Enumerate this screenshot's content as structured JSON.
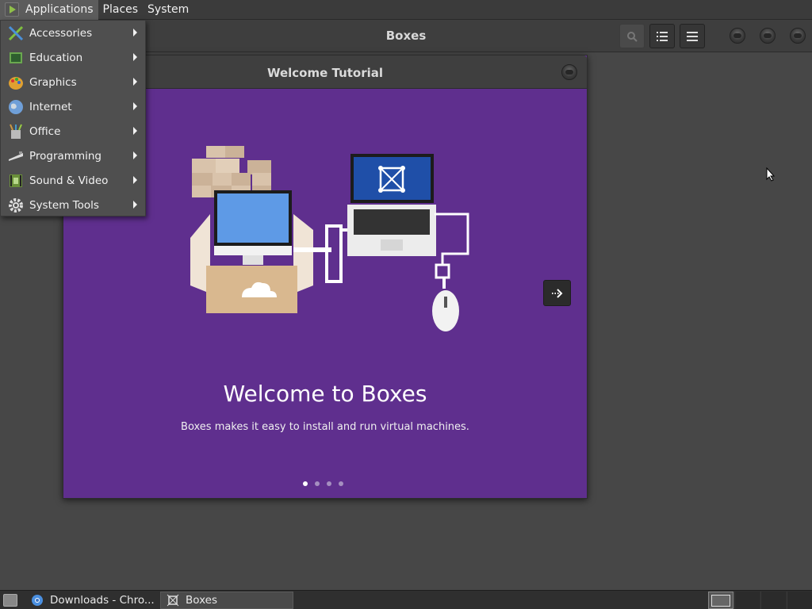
{
  "top_panel": {
    "menus": [
      {
        "label": "Applications",
        "active": true
      },
      {
        "label": "Places"
      },
      {
        "label": "System"
      }
    ]
  },
  "boxes_window": {
    "title": "Boxes"
  },
  "tutorial": {
    "title": "Welcome Tutorial",
    "heading": "Welcome to Boxes",
    "description": "Boxes makes it easy to install and run virtual machines.",
    "current_page": 1,
    "total_pages": 4
  },
  "applications_menu": {
    "items": [
      {
        "label": "Accessories",
        "icon": "accessories-icon"
      },
      {
        "label": "Education",
        "icon": "education-icon"
      },
      {
        "label": "Graphics",
        "icon": "graphics-icon"
      },
      {
        "label": "Internet",
        "icon": "internet-icon"
      },
      {
        "label": "Office",
        "icon": "office-icon"
      },
      {
        "label": "Programming",
        "icon": "programming-icon"
      },
      {
        "label": "Sound & Video",
        "icon": "sound-video-icon"
      },
      {
        "label": "System Tools",
        "icon": "system-tools-icon"
      }
    ]
  },
  "taskbar": {
    "tasks": [
      {
        "label": "Downloads - Chro...",
        "icon": "chrome-icon",
        "active": false
      },
      {
        "label": "Boxes",
        "icon": "boxes-icon",
        "active": true
      }
    ],
    "workspaces": 4
  },
  "colors": {
    "accent_purple": "#5f2f8e",
    "panel_bg": "#3b3b3b",
    "menu_bg": "#4f4f4f"
  }
}
